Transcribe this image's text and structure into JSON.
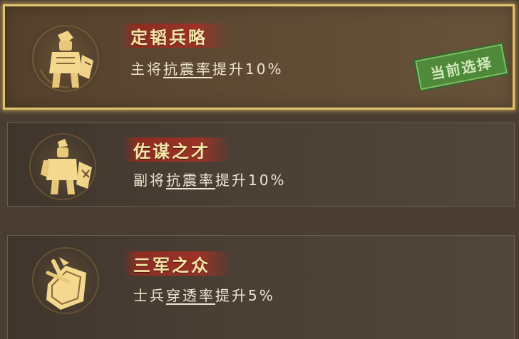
{
  "options": [
    {
      "title": "定韬兵略",
      "desc_prefix": "主将",
      "desc_keyword": "抗震率",
      "desc_suffix": "提升10%",
      "icon": "general-armor-icon",
      "selected": true,
      "stamp_label": "当前选择"
    },
    {
      "title": "佐谋之才",
      "desc_prefix": "副将",
      "desc_keyword": "抗震率",
      "desc_suffix": "提升10%",
      "icon": "lieutenant-armor-icon",
      "selected": false
    },
    {
      "title": "三军之众",
      "desc_prefix": "士兵",
      "desc_keyword": "穿透率",
      "desc_suffix": "提升5%",
      "icon": "shield-spear-icon",
      "selected": false
    }
  ],
  "colors": {
    "title_text": "#f6e7a8",
    "title_plate": "#9b3326",
    "selected_border": "#e3c46a",
    "stamp_green": "#4d8e3a"
  }
}
